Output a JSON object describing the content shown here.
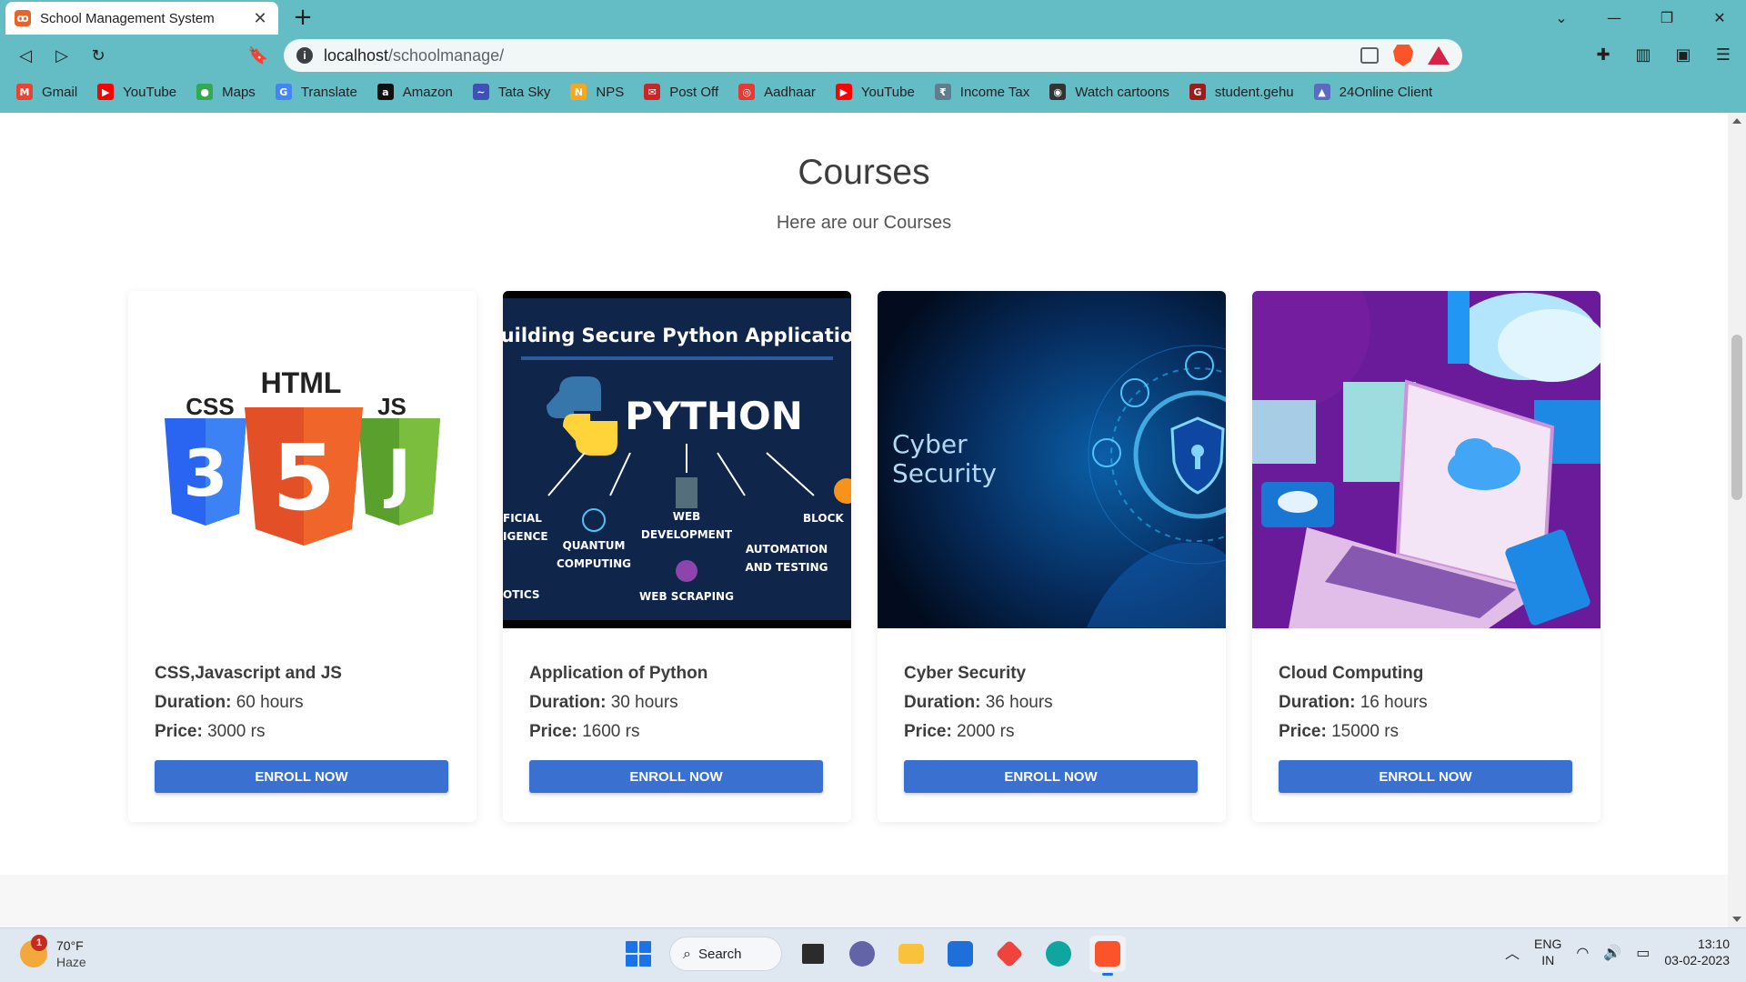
{
  "browser": {
    "tab_title": "School Management System",
    "url_host": "localhost",
    "url_path": "/schoolmanage/",
    "bookmarks": [
      {
        "label": "Gmail",
        "icon": "gmail-icon",
        "color": "#ea4335",
        "glyph": "M"
      },
      {
        "label": "YouTube",
        "icon": "youtube-icon",
        "color": "#ff0000",
        "glyph": "▶"
      },
      {
        "label": "Maps",
        "icon": "maps-icon",
        "color": "#34a853",
        "glyph": "●"
      },
      {
        "label": "Translate",
        "icon": "translate-icon",
        "color": "#4285f4",
        "glyph": "G"
      },
      {
        "label": "Amazon",
        "icon": "amazon-icon",
        "color": "#111111",
        "glyph": "a"
      },
      {
        "label": "Tata Sky",
        "icon": "tatasky-icon",
        "color": "#3f51b5",
        "glyph": "~"
      },
      {
        "label": "NPS",
        "icon": "nps-icon",
        "color": "#f5a623",
        "glyph": "N"
      },
      {
        "label": "Post Off",
        "icon": "postoffice-icon",
        "color": "#c62828",
        "glyph": "✉"
      },
      {
        "label": "Aadhaar",
        "icon": "aadhaar-icon",
        "color": "#e53935",
        "glyph": "◎"
      },
      {
        "label": "YouTube",
        "icon": "youtube-icon",
        "color": "#ff0000",
        "glyph": "▶"
      },
      {
        "label": "Income Tax",
        "icon": "incometax-icon",
        "color": "#607d8b",
        "glyph": "₹"
      },
      {
        "label": "Watch cartoons",
        "icon": "globe-icon",
        "color": "#333333",
        "glyph": "◉"
      },
      {
        "label": "student.gehu",
        "icon": "gehu-icon",
        "color": "#9e1b1b",
        "glyph": "G"
      },
      {
        "label": "24Online Client",
        "icon": "24online-icon",
        "color": "#5c6bc0",
        "glyph": "▲"
      }
    ]
  },
  "courses_section": {
    "title": "Courses",
    "subtitle": "Here are our Courses",
    "enroll_label": "ENROLL NOW",
    "duration_label": "Duration:",
    "price_label": "Price:",
    "courses": [
      {
        "name": "CSS,Javascript and JS",
        "duration": "60 hours",
        "price": "3000 rs",
        "image_text_top": "HTML",
        "image_text_left": "CSS",
        "image_text_right": "JS"
      },
      {
        "name": "Application of Python",
        "duration": "30 hours",
        "price": "1600 rs",
        "image_text_top": "Building Secure Python Application",
        "image_text_main": "PYTHON",
        "image_tags": [
          "FICIAL IGENCE",
          "QUANTUM COMPUTING",
          "WEB DEVELOPMENT",
          "AUTOMATION AND TESTING",
          "BLOCK",
          "WEB SCRAPING",
          "OTICS"
        ]
      },
      {
        "name": "Cyber Security",
        "duration": "36 hours",
        "price": "2000 rs",
        "image_text_main": "Cyber Security"
      },
      {
        "name": "Cloud Computing",
        "duration": "16 hours",
        "price": "15000 rs"
      }
    ]
  },
  "taskbar": {
    "weather_temp": "70°F",
    "weather_cond": "Haze",
    "weather_badge": "1",
    "search_label": "Search",
    "lang_top": "ENG",
    "lang_bottom": "IN",
    "time": "13:10",
    "date": "03-02-2023"
  }
}
